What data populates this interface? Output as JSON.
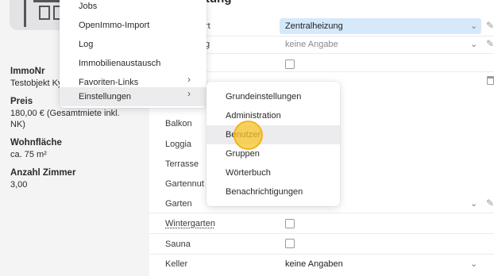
{
  "property": {
    "immonr_label": "ImmoNr",
    "immonr_value": "Testobjekt Ky",
    "preis_label": "Preis",
    "preis_line1": "180,00 € (Gesamtmiete inkl.",
    "preis_line2": "NK)",
    "wohnflaeche_label": "Wohnfläche",
    "wohnflaeche_value": "ca. 75 m²",
    "zimmer_label": "Anzahl Zimmer",
    "zimmer_value": "3,00"
  },
  "panel": {
    "title_fragment": "tung",
    "row1_label_fragment": "rt",
    "row1_value": "Zentralheizung",
    "row2_label_fragment": "g",
    "row2_value": "keine Angabe",
    "balkon": "Balkon",
    "loggia": "Loggia",
    "terrasse": "Terrasse",
    "gartennutzung": "Gartennut",
    "garten": "Garten",
    "wintergarten": "Wintergarten",
    "sauna": "Sauna",
    "keller": "Keller",
    "keller_value": "keine Angaben"
  },
  "menu": {
    "items": [
      "Jobs",
      "OpenImmo-Import",
      "Log",
      "Immobilienaustausch",
      "Favoriten-Links",
      "Einstellungen"
    ]
  },
  "submenu": {
    "items": [
      "Grundeinstellungen",
      "Administration",
      "Benutzer",
      "Gruppen",
      "Wörterbuch",
      "Benachrichtigungen"
    ]
  },
  "colors": {
    "select_highlight": "#d5e9fb",
    "cursor_highlight": "#f9c52a",
    "menu_active": "#ececee"
  }
}
